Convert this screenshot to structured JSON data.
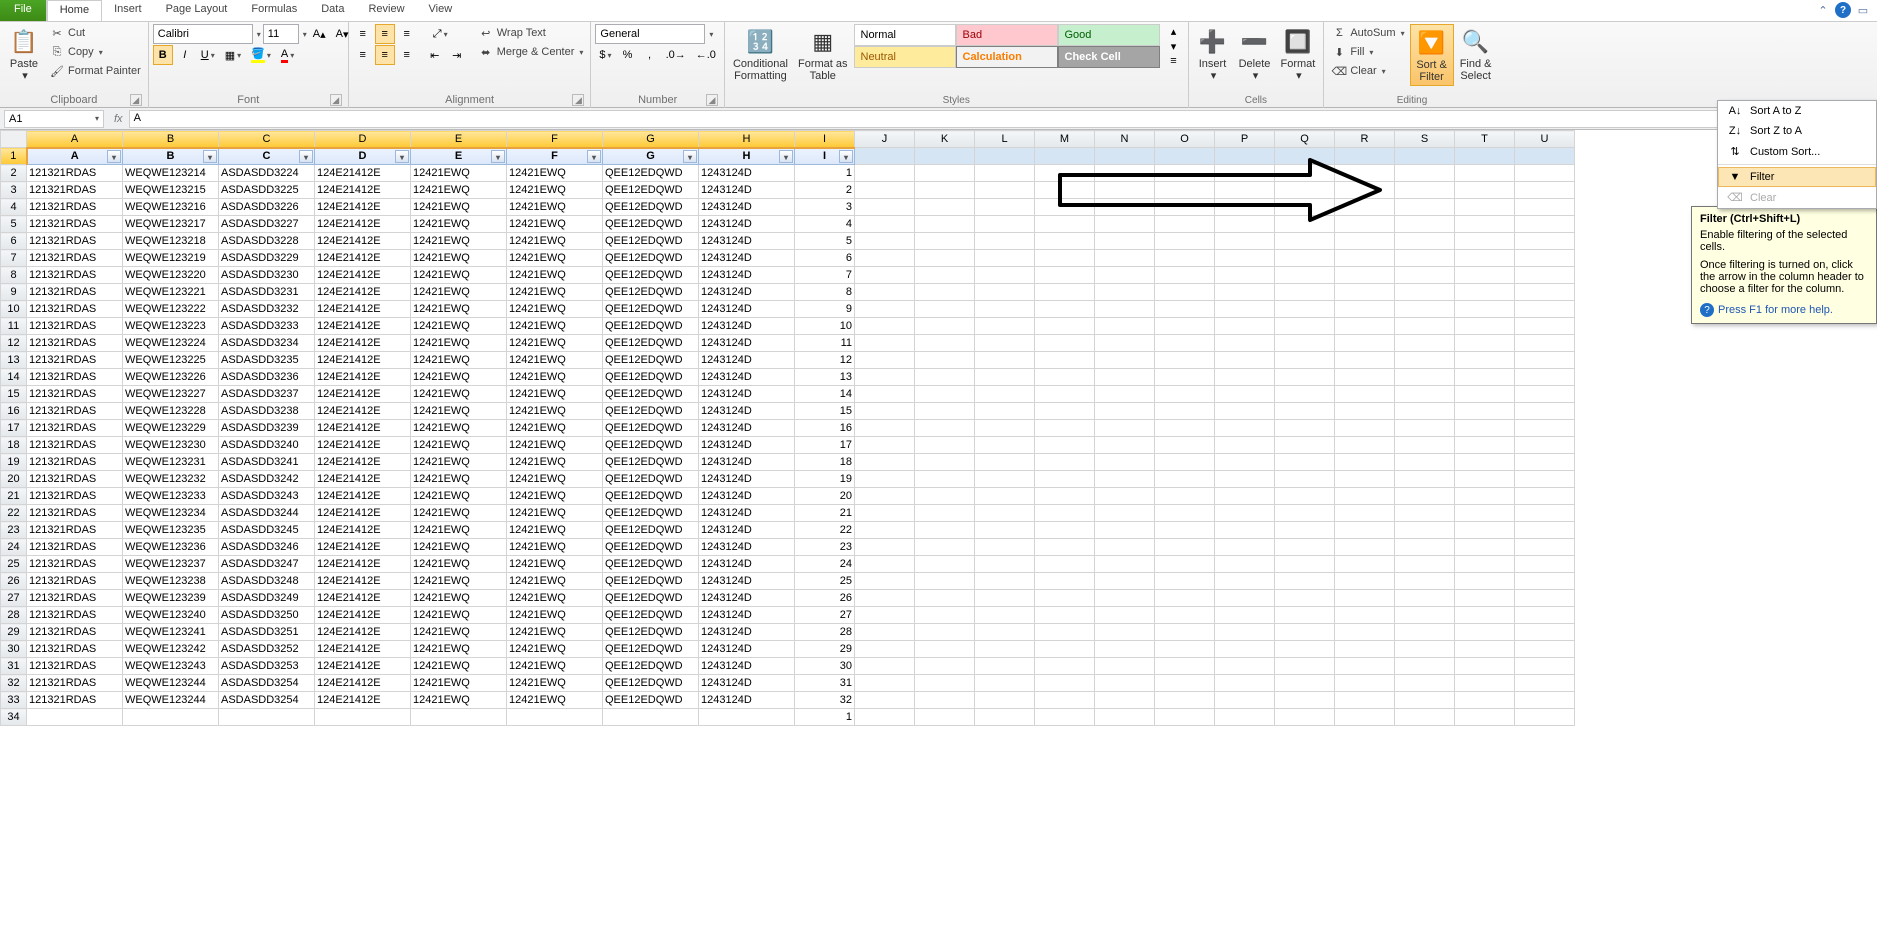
{
  "tabs": {
    "file": "File",
    "home": "Home",
    "insert": "Insert",
    "page_layout": "Page Layout",
    "formulas": "Formulas",
    "data": "Data",
    "review": "Review",
    "view": "View"
  },
  "clipboard": {
    "paste": "Paste",
    "cut": "Cut",
    "copy": "Copy",
    "format_painter": "Format Painter",
    "label": "Clipboard"
  },
  "font": {
    "name": "Calibri",
    "size": "11",
    "label": "Font"
  },
  "alignment": {
    "wrap": "Wrap Text",
    "merge": "Merge & Center",
    "label": "Alignment"
  },
  "number": {
    "format": "General",
    "label": "Number"
  },
  "cond_format": "Conditional\nFormatting",
  "format_table": "Format as\nTable",
  "styles": {
    "normal": "Normal",
    "bad": "Bad",
    "good": "Good",
    "neutral": "Neutral",
    "calc": "Calculation",
    "check": "Check Cell",
    "label": "Styles"
  },
  "cells": {
    "insert": "Insert",
    "delete": "Delete",
    "format": "Format",
    "label": "Cells"
  },
  "editing": {
    "autosum": "AutoSum",
    "fill": "Fill",
    "clear": "Clear",
    "sort_filter": "Sort &\nFilter",
    "find_select": "Find &\nSelect",
    "label": "Editing"
  },
  "menu": {
    "sort_az": "Sort A to Z",
    "sort_za": "Sort Z to A",
    "custom_sort": "Custom Sort...",
    "filter": "Filter",
    "clear": "Clear"
  },
  "tooltip": {
    "title": "Filter (Ctrl+Shift+L)",
    "body1": "Enable filtering of the selected cells.",
    "body2": "Once filtering is turned on, click the arrow in the column header to choose a filter for the column.",
    "help": "Press F1 for more help."
  },
  "name_box": "A1",
  "formula_value": "A",
  "col_letters": [
    "A",
    "B",
    "C",
    "D",
    "E",
    "F",
    "G",
    "H",
    "I",
    "J",
    "K",
    "L",
    "M",
    "N",
    "O",
    "P",
    "Q",
    "R",
    "S",
    "T",
    "U"
  ],
  "headers": [
    "A",
    "B",
    "C",
    "D",
    "E",
    "F",
    "G",
    "H",
    "I"
  ],
  "rows": [
    {
      "n": 1,
      "A": "121321RDAS",
      "B": "WEQWE123214",
      "C": "ASDASDD3224",
      "D": "124E21412E",
      "E": "12421EWQ",
      "F": "12421EWQ",
      "G": "QEE12EDQWD",
      "H": "1243124D",
      "I": "1"
    },
    {
      "n": 2,
      "A": "121321RDAS",
      "B": "WEQWE123215",
      "C": "ASDASDD3225",
      "D": "124E21412E",
      "E": "12421EWQ",
      "F": "12421EWQ",
      "G": "QEE12EDQWD",
      "H": "1243124D",
      "I": "2"
    },
    {
      "n": 3,
      "A": "121321RDAS",
      "B": "WEQWE123216",
      "C": "ASDASDD3226",
      "D": "124E21412E",
      "E": "12421EWQ",
      "F": "12421EWQ",
      "G": "QEE12EDQWD",
      "H": "1243124D",
      "I": "3"
    },
    {
      "n": 4,
      "A": "121321RDAS",
      "B": "WEQWE123217",
      "C": "ASDASDD3227",
      "D": "124E21412E",
      "E": "12421EWQ",
      "F": "12421EWQ",
      "G": "QEE12EDQWD",
      "H": "1243124D",
      "I": "4"
    },
    {
      "n": 5,
      "A": "121321RDAS",
      "B": "WEQWE123218",
      "C": "ASDASDD3228",
      "D": "124E21412E",
      "E": "12421EWQ",
      "F": "12421EWQ",
      "G": "QEE12EDQWD",
      "H": "1243124D",
      "I": "5"
    },
    {
      "n": 6,
      "A": "121321RDAS",
      "B": "WEQWE123219",
      "C": "ASDASDD3229",
      "D": "124E21412E",
      "E": "12421EWQ",
      "F": "12421EWQ",
      "G": "QEE12EDQWD",
      "H": "1243124D",
      "I": "6"
    },
    {
      "n": 7,
      "A": "121321RDAS",
      "B": "WEQWE123220",
      "C": "ASDASDD3230",
      "D": "124E21412E",
      "E": "12421EWQ",
      "F": "12421EWQ",
      "G": "QEE12EDQWD",
      "H": "1243124D",
      "I": "7"
    },
    {
      "n": 8,
      "A": "121321RDAS",
      "B": "WEQWE123221",
      "C": "ASDASDD3231",
      "D": "124E21412E",
      "E": "12421EWQ",
      "F": "12421EWQ",
      "G": "QEE12EDQWD",
      "H": "1243124D",
      "I": "8"
    },
    {
      "n": 9,
      "A": "121321RDAS",
      "B": "WEQWE123222",
      "C": "ASDASDD3232",
      "D": "124E21412E",
      "E": "12421EWQ",
      "F": "12421EWQ",
      "G": "QEE12EDQWD",
      "H": "1243124D",
      "I": "9"
    },
    {
      "n": 10,
      "A": "121321RDAS",
      "B": "WEQWE123223",
      "C": "ASDASDD3233",
      "D": "124E21412E",
      "E": "12421EWQ",
      "F": "12421EWQ",
      "G": "QEE12EDQWD",
      "H": "1243124D",
      "I": "10"
    },
    {
      "n": 11,
      "A": "121321RDAS",
      "B": "WEQWE123224",
      "C": "ASDASDD3234",
      "D": "124E21412E",
      "E": "12421EWQ",
      "F": "12421EWQ",
      "G": "QEE12EDQWD",
      "H": "1243124D",
      "I": "11"
    },
    {
      "n": 12,
      "A": "121321RDAS",
      "B": "WEQWE123225",
      "C": "ASDASDD3235",
      "D": "124E21412E",
      "E": "12421EWQ",
      "F": "12421EWQ",
      "G": "QEE12EDQWD",
      "H": "1243124D",
      "I": "12"
    },
    {
      "n": 13,
      "A": "121321RDAS",
      "B": "WEQWE123226",
      "C": "ASDASDD3236",
      "D": "124E21412E",
      "E": "12421EWQ",
      "F": "12421EWQ",
      "G": "QEE12EDQWD",
      "H": "1243124D",
      "I": "13"
    },
    {
      "n": 14,
      "A": "121321RDAS",
      "B": "WEQWE123227",
      "C": "ASDASDD3237",
      "D": "124E21412E",
      "E": "12421EWQ",
      "F": "12421EWQ",
      "G": "QEE12EDQWD",
      "H": "1243124D",
      "I": "14"
    },
    {
      "n": 15,
      "A": "121321RDAS",
      "B": "WEQWE123228",
      "C": "ASDASDD3238",
      "D": "124E21412E",
      "E": "12421EWQ",
      "F": "12421EWQ",
      "G": "QEE12EDQWD",
      "H": "1243124D",
      "I": "15"
    },
    {
      "n": 16,
      "A": "121321RDAS",
      "B": "WEQWE123229",
      "C": "ASDASDD3239",
      "D": "124E21412E",
      "E": "12421EWQ",
      "F": "12421EWQ",
      "G": "QEE12EDQWD",
      "H": "1243124D",
      "I": "16"
    },
    {
      "n": 17,
      "A": "121321RDAS",
      "B": "WEQWE123230",
      "C": "ASDASDD3240",
      "D": "124E21412E",
      "E": "12421EWQ",
      "F": "12421EWQ",
      "G": "QEE12EDQWD",
      "H": "1243124D",
      "I": "17"
    },
    {
      "n": 18,
      "A": "121321RDAS",
      "B": "WEQWE123231",
      "C": "ASDASDD3241",
      "D": "124E21412E",
      "E": "12421EWQ",
      "F": "12421EWQ",
      "G": "QEE12EDQWD",
      "H": "1243124D",
      "I": "18"
    },
    {
      "n": 19,
      "A": "121321RDAS",
      "B": "WEQWE123232",
      "C": "ASDASDD3242",
      "D": "124E21412E",
      "E": "12421EWQ",
      "F": "12421EWQ",
      "G": "QEE12EDQWD",
      "H": "1243124D",
      "I": "19"
    },
    {
      "n": 20,
      "A": "121321RDAS",
      "B": "WEQWE123233",
      "C": "ASDASDD3243",
      "D": "124E21412E",
      "E": "12421EWQ",
      "F": "12421EWQ",
      "G": "QEE12EDQWD",
      "H": "1243124D",
      "I": "20"
    },
    {
      "n": 21,
      "A": "121321RDAS",
      "B": "WEQWE123234",
      "C": "ASDASDD3244",
      "D": "124E21412E",
      "E": "12421EWQ",
      "F": "12421EWQ",
      "G": "QEE12EDQWD",
      "H": "1243124D",
      "I": "21"
    },
    {
      "n": 22,
      "A": "121321RDAS",
      "B": "WEQWE123235",
      "C": "ASDASDD3245",
      "D": "124E21412E",
      "E": "12421EWQ",
      "F": "12421EWQ",
      "G": "QEE12EDQWD",
      "H": "1243124D",
      "I": "22"
    },
    {
      "n": 23,
      "A": "121321RDAS",
      "B": "WEQWE123236",
      "C": "ASDASDD3246",
      "D": "124E21412E",
      "E": "12421EWQ",
      "F": "12421EWQ",
      "G": "QEE12EDQWD",
      "H": "1243124D",
      "I": "23"
    },
    {
      "n": 24,
      "A": "121321RDAS",
      "B": "WEQWE123237",
      "C": "ASDASDD3247",
      "D": "124E21412E",
      "E": "12421EWQ",
      "F": "12421EWQ",
      "G": "QEE12EDQWD",
      "H": "1243124D",
      "I": "24"
    },
    {
      "n": 25,
      "A": "121321RDAS",
      "B": "WEQWE123238",
      "C": "ASDASDD3248",
      "D": "124E21412E",
      "E": "12421EWQ",
      "F": "12421EWQ",
      "G": "QEE12EDQWD",
      "H": "1243124D",
      "I": "25"
    },
    {
      "n": 26,
      "A": "121321RDAS",
      "B": "WEQWE123239",
      "C": "ASDASDD3249",
      "D": "124E21412E",
      "E": "12421EWQ",
      "F": "12421EWQ",
      "G": "QEE12EDQWD",
      "H": "1243124D",
      "I": "26"
    },
    {
      "n": 27,
      "A": "121321RDAS",
      "B": "WEQWE123240",
      "C": "ASDASDD3250",
      "D": "124E21412E",
      "E": "12421EWQ",
      "F": "12421EWQ",
      "G": "QEE12EDQWD",
      "H": "1243124D",
      "I": "27"
    },
    {
      "n": 28,
      "A": "121321RDAS",
      "B": "WEQWE123241",
      "C": "ASDASDD3251",
      "D": "124E21412E",
      "E": "12421EWQ",
      "F": "12421EWQ",
      "G": "QEE12EDQWD",
      "H": "1243124D",
      "I": "28"
    },
    {
      "n": 29,
      "A": "121321RDAS",
      "B": "WEQWE123242",
      "C": "ASDASDD3252",
      "D": "124E21412E",
      "E": "12421EWQ",
      "F": "12421EWQ",
      "G": "QEE12EDQWD",
      "H": "1243124D",
      "I": "29"
    },
    {
      "n": 30,
      "A": "121321RDAS",
      "B": "WEQWE123243",
      "C": "ASDASDD3253",
      "D": "124E21412E",
      "E": "12421EWQ",
      "F": "12421EWQ",
      "G": "QEE12EDQWD",
      "H": "1243124D",
      "I": "30"
    },
    {
      "n": 31,
      "A": "121321RDAS",
      "B": "WEQWE123244",
      "C": "ASDASDD3254",
      "D": "124E21412E",
      "E": "12421EWQ",
      "F": "12421EWQ",
      "G": "QEE12EDQWD",
      "H": "1243124D",
      "I": "31"
    },
    {
      "n": 32,
      "A": "121321RDAS",
      "B": "WEQWE123244",
      "C": "ASDASDD3254",
      "D": "124E21412E",
      "E": "12421EWQ",
      "F": "12421EWQ",
      "G": "QEE12EDQWD",
      "H": "1243124D",
      "I": "32"
    },
    {
      "n": 33,
      "A": "",
      "B": "",
      "C": "",
      "D": "",
      "E": "",
      "F": "",
      "G": "",
      "H": "",
      "I": "1"
    }
  ]
}
